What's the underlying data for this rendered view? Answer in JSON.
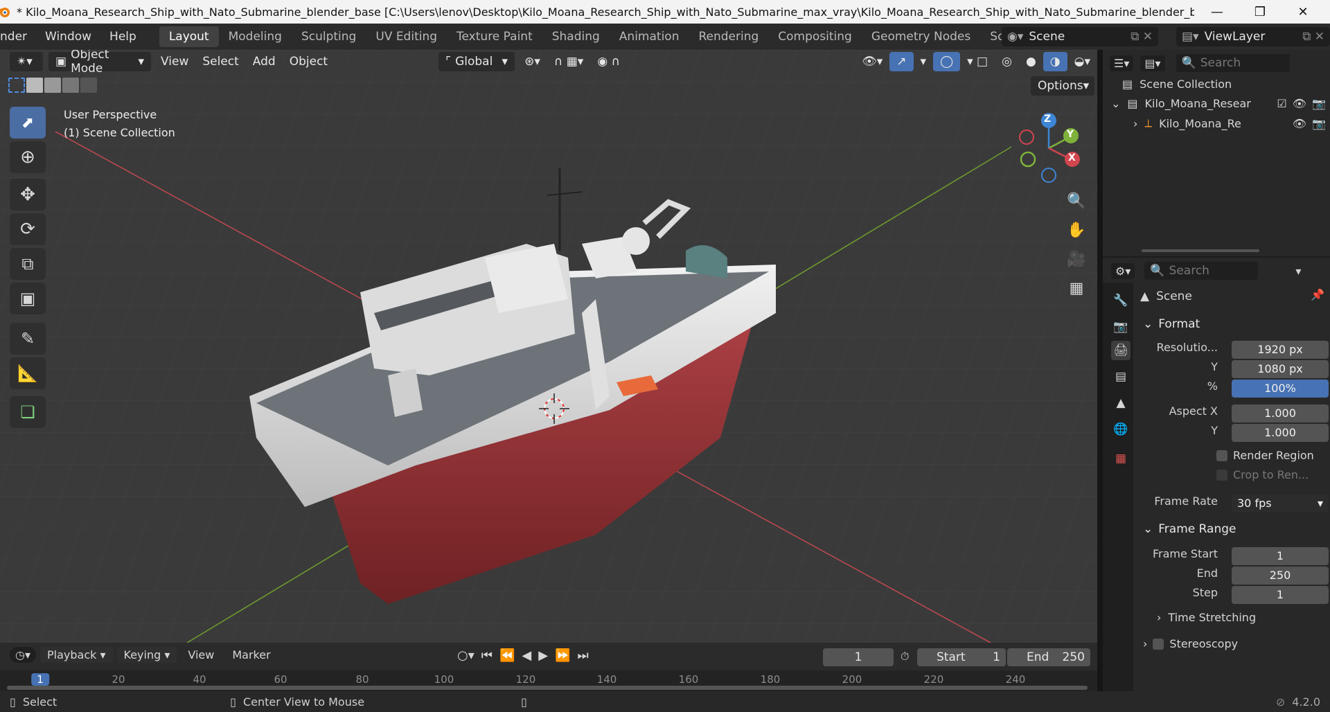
{
  "window": {
    "title": "* Kilo_Moana_Research_Ship_with_Nato_Submarine_blender_base [C:\\Users\\lenov\\Desktop\\Kilo_Moana_Research_Ship_with_Nato_Submarine_max_vray\\Kilo_Moana_Research_Ship_with_Nato_Submarine_blender_base.blend] ...",
    "minimize_icon": "minimize-icon",
    "maximize_icon": "restore-icon",
    "close_icon": "close-icon"
  },
  "menubar": {
    "menus": [
      "nder",
      "Window",
      "Help"
    ],
    "workspaces": [
      "Layout",
      "Modeling",
      "Sculpting",
      "UV Editing",
      "Texture Paint",
      "Shading",
      "Animation",
      "Rendering",
      "Compositing",
      "Geometry Nodes",
      "Scripting"
    ],
    "active_workspace": "Layout",
    "scene_name": "Scene",
    "view_layer": "ViewLayer"
  },
  "viewport": {
    "mode": "Object Mode",
    "menus": [
      "View",
      "Select",
      "Add",
      "Object"
    ],
    "transform_orientation": "Global",
    "options_label": "Options",
    "overlay_title": "User Perspective",
    "overlay_collection": "(1) Scene Collection",
    "gizmo_axes": {
      "x": "X",
      "y": "Y",
      "z": "Z"
    },
    "colors": {
      "x_axis": "#d1454f",
      "y_axis": "#7fb23a",
      "z_axis": "#3d85d6",
      "background": "#3a3a3a"
    }
  },
  "outliner": {
    "search_placeholder": "Search",
    "root": "Scene Collection",
    "collection": "Kilo_Moana_Resear",
    "object": "Kilo_Moana_Re"
  },
  "properties": {
    "search_placeholder": "Search",
    "context": "Scene",
    "format_panel": "Format",
    "resolution_x_label": "Resolutio...",
    "resolution_x": "1920 px",
    "resolution_y_label": "Y",
    "resolution_y": "1080 px",
    "percent_label": "%",
    "percent": "100%",
    "aspect_x_label": "Aspect X",
    "aspect_x": "1.000",
    "aspect_y_label": "Y",
    "aspect_y": "1.000",
    "render_region": "Render Region",
    "crop": "Crop to Ren...",
    "frame_rate_label": "Frame Rate",
    "frame_rate": "30 fps",
    "frame_range_panel": "Frame Range",
    "frame_start_label": "Frame Start",
    "frame_start": "1",
    "end_label": "End",
    "end": "250",
    "step_label": "Step",
    "step": "1",
    "time_stretching": "Time Stretching",
    "stereoscopy": "Stereoscopy"
  },
  "timeline": {
    "menus": [
      "Playback",
      "Keying",
      "View",
      "Marker"
    ],
    "current_frame": "1",
    "start_label": "Start",
    "start": "1",
    "end_label": "End",
    "end": "250",
    "ruler": [
      "1",
      "20",
      "40",
      "60",
      "80",
      "100",
      "120",
      "140",
      "160",
      "180",
      "200",
      "220",
      "240"
    ]
  },
  "statusbar": {
    "left": "Select",
    "middle": "Center View to Mouse",
    "version": "4.2.0"
  }
}
